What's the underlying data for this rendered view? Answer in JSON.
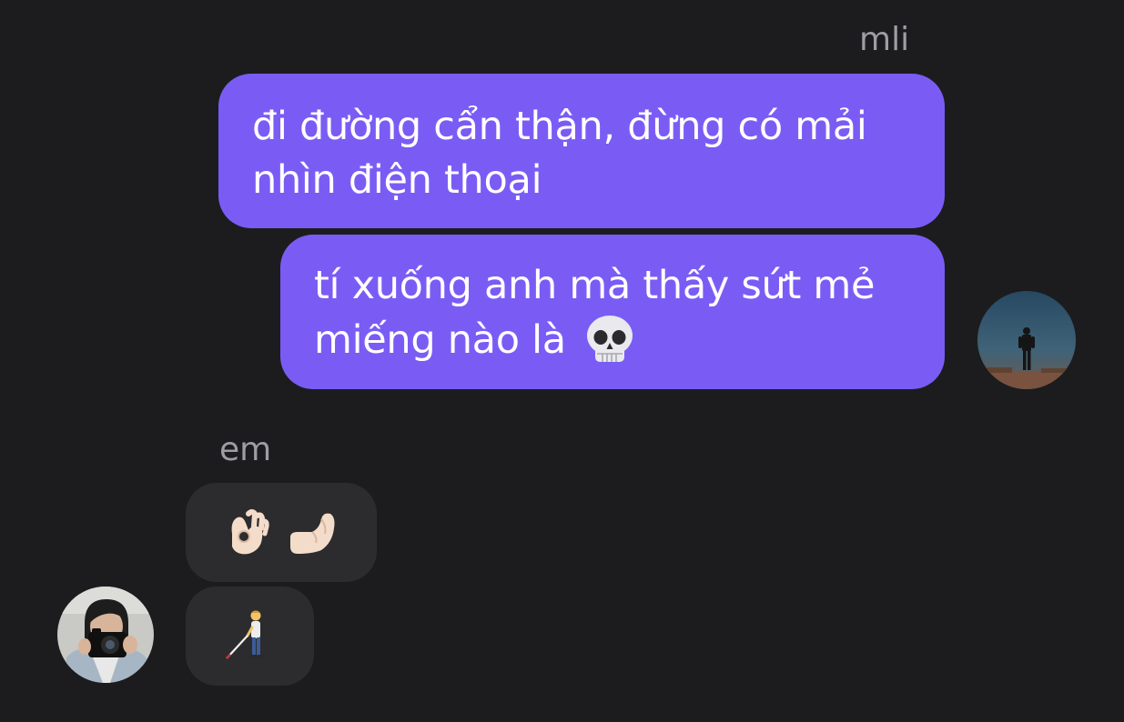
{
  "thread": {
    "outgoing_sender": "mli",
    "incoming_sender": "em",
    "messages": [
      {
        "from": "mli",
        "text": "đi đường cẩn thận, đừng có mải nhìn điện thoại",
        "lines": [
          "đi đường cẩn thận, đừng có mải",
          "nhìn điện thoại"
        ]
      },
      {
        "from": "mli",
        "text": "tí xuống anh mà thấy sứt mẻ miếng nào là 💀",
        "lines": [
          "tí xuống anh mà thấy sứt mẻ",
          "miếng nào là"
        ],
        "trailing_emoji": "skull-emoji"
      },
      {
        "from": "em",
        "emojis": [
          "ok-hand-emoji",
          "pinching-hand-emoji"
        ]
      },
      {
        "from": "em",
        "emojis": [
          "person-with-white-cane-emoji"
        ]
      }
    ]
  },
  "colors": {
    "background": "#1c1c1e",
    "outgoing_bubble": "#7a5cf5",
    "incoming_bubble": "#2c2c2e",
    "sender_name": "#9d9da3",
    "message_text": "#ffffff"
  },
  "avatars": {
    "outgoing": "avatar-silhouette-at-sunset",
    "incoming": "avatar-person-with-camera"
  }
}
